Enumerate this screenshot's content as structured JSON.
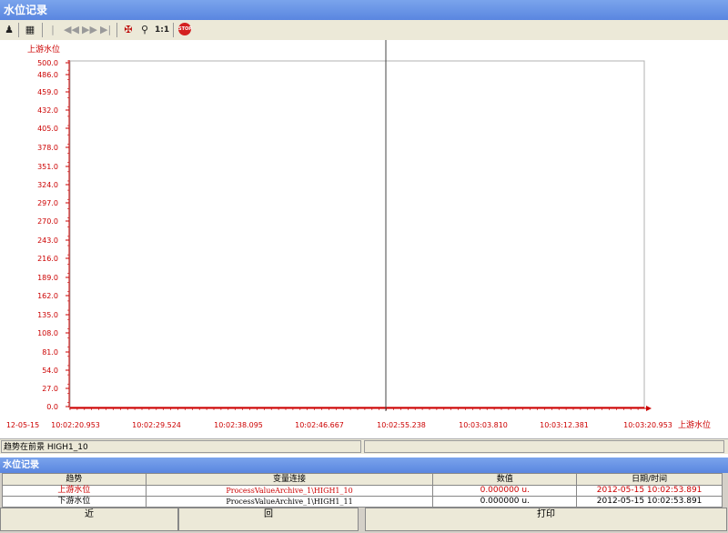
{
  "window": {
    "title": "水位记录"
  },
  "toolbar": {
    "zoom_label": "1:1",
    "stop_label": "STOP"
  },
  "chart_data": {
    "type": "line",
    "ylabel": "上游水位",
    "xlabel": "上游水位",
    "ylim": [
      0,
      500
    ],
    "yticks": [
      "500.0",
      "486.0",
      "459.0",
      "432.0",
      "405.0",
      "378.0",
      "351.0",
      "324.0",
      "297.0",
      "270.0",
      "243.0",
      "216.0",
      "189.0",
      "162.0",
      "135.0",
      "108.0",
      "81.0",
      "54.0",
      "27.0",
      "0.0"
    ],
    "xticks": [
      "12-05-15",
      "10:02:20.953",
      "10:02:29.524",
      "10:02:38.095",
      "10:02:46.667",
      "10:02:55.238",
      "10:03:03.810",
      "10:03:12.381",
      "10:03:20.953"
    ],
    "series": [
      {
        "name": "上游水位",
        "color": "#cc0000",
        "value": 0
      }
    ],
    "cursor_time": "10:02:53.891",
    "grid": false
  },
  "status": {
    "text": "趋势在前景 HIGH1_10"
  },
  "panel2": {
    "title": "水位记录"
  },
  "table": {
    "headers": [
      "趋势",
      "变量连接",
      "数值",
      "日期/时间"
    ],
    "rows": [
      {
        "trend": "上游水位",
        "var": "ProcessValueArchive_1\\HIGH1_10",
        "value": "0.000000 u.",
        "datetime": "2012-05-15 10:02:53.891",
        "color": "#cc0000"
      },
      {
        "trend": "下游水位",
        "var": "ProcessValueArchive_1\\HIGH1_11",
        "value": "0.000000 u.",
        "datetime": "2012-05-15 10:02:53.891",
        "color": "#000000"
      }
    ]
  },
  "buttons": {
    "prev": "近",
    "back": "回",
    "print": "打印"
  }
}
